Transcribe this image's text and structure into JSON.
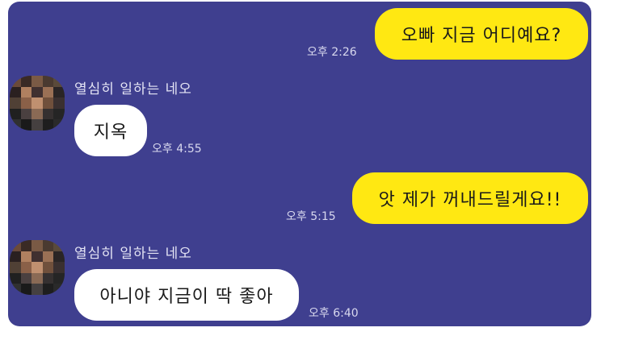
{
  "messages": [
    {
      "direction": "outgoing",
      "text": "오빠 지금 어디예요?",
      "time": "오후 2:26"
    },
    {
      "direction": "incoming",
      "sender": "열심히 일하는 네오",
      "avatar_icon": "pixelated-avatar-icon",
      "text": "지옥",
      "time": "오후 4:55"
    },
    {
      "direction": "outgoing",
      "text": "앗 제가 꺼내드릴게요!!",
      "time": "오후 5:15"
    },
    {
      "direction": "incoming",
      "sender": "열심히 일하는 네오",
      "avatar_icon": "pixelated-avatar-icon",
      "text": "아니야 지금이 딱 좋아",
      "time": "오후 6:40"
    }
  ],
  "colors": {
    "chat_background": "#3f3f8f",
    "outgoing_bubble": "#ffe812",
    "incoming_bubble": "#ffffff",
    "timestamp_text": "#d8d8ee"
  }
}
